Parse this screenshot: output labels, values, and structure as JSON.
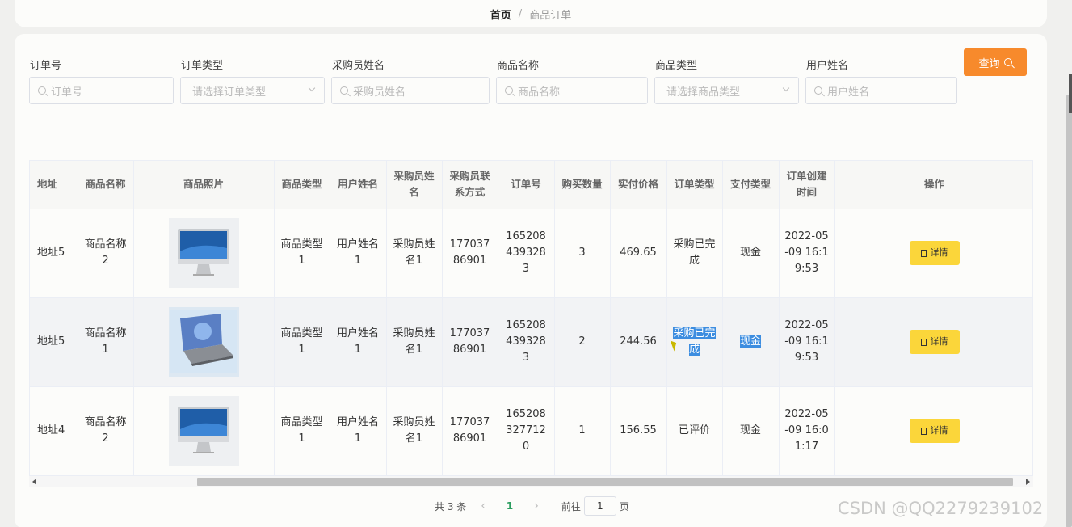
{
  "breadcrumb": {
    "home": "首页",
    "sep": "/",
    "current": "商品订单"
  },
  "filters": [
    {
      "label": "订单号",
      "placeholder": "订单号",
      "type": "input"
    },
    {
      "label": "订单类型",
      "placeholder": "请选择订单类型",
      "type": "select"
    },
    {
      "label": "采购员姓名",
      "placeholder": "采购员姓名",
      "type": "input"
    },
    {
      "label": "商品名称",
      "placeholder": "商品名称",
      "type": "input"
    },
    {
      "label": "商品类型",
      "placeholder": "请选择商品类型",
      "type": "select"
    },
    {
      "label": "用户姓名",
      "placeholder": "用户姓名",
      "type": "input"
    }
  ],
  "query_button": "查询",
  "table": {
    "columns": [
      "地址",
      "商品名称",
      "商品照片",
      "商品类型",
      "用户姓名",
      "采购员姓名",
      "采购员联系方式",
      "订单号",
      "购买数量",
      "实付价格",
      "订单类型",
      "支付类型",
      "订单创建时间",
      "操作"
    ],
    "rows": [
      {
        "address": "地址5",
        "name": "商品名称2",
        "photo": "imac-icon",
        "type": "商品类型1",
        "user": "用户姓名1",
        "buyer": "采购员姓名1",
        "phone": "17703786901",
        "order_no": "1652084393283",
        "qty": "3",
        "price": "469.65",
        "order_type": "采购已完成",
        "pay_type": "现金",
        "created": "2022-05-09 16:19:53",
        "action": "详情"
      },
      {
        "address": "地址5",
        "name": "商品名称1",
        "photo": "laptop-icon",
        "type": "商品类型1",
        "user": "用户姓名1",
        "buyer": "采购员姓名1",
        "phone": "17703786901",
        "order_no": "1652084393283",
        "qty": "2",
        "price": "244.56",
        "order_type": "采购已完成",
        "pay_type": "现金",
        "created": "2022-05-09 16:19:53",
        "action": "详情"
      },
      {
        "address": "地址4",
        "name": "商品名称2",
        "photo": "imac-icon",
        "type": "商品类型1",
        "user": "用户姓名1",
        "buyer": "采购员姓名1",
        "phone": "17703786901",
        "order_no": "1652083277120",
        "qty": "1",
        "price": "156.55",
        "order_type": "已评价",
        "pay_type": "现金",
        "created": "2022-05-09 16:01:17",
        "action": "详情"
      }
    ]
  },
  "pagination": {
    "total": "共 3 条",
    "current": "1",
    "goto_prefix": "前往",
    "goto_value": "1",
    "goto_suffix": "页",
    "prev": "‹",
    "next": "›"
  },
  "watermark": "CSDN @QQ2279239102",
  "colors": {
    "query_button": "#f78a2c",
    "detail_button": "#fbd63a",
    "selection": "#3d8de0",
    "pager_active": "#2a9d5f"
  }
}
